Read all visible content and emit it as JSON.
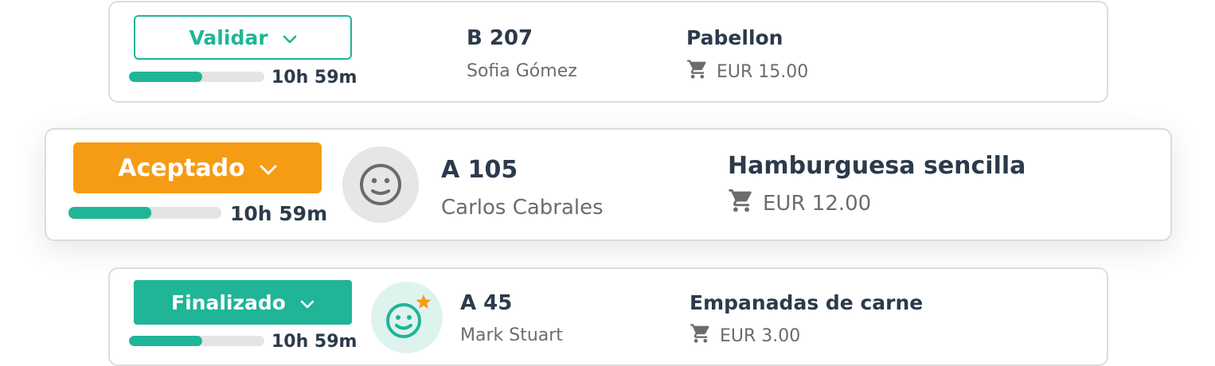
{
  "colors": {
    "accent_green": "#1fb596",
    "accent_orange": "#f69c14",
    "progress_track": "#e4e4e4",
    "text_dark": "#2c3a4b",
    "text_muted": "#6c6c6c"
  },
  "orders": [
    {
      "status_label": "Validar",
      "status_icon": "chevron-down-icon",
      "progress_fraction": 0.54,
      "time": "10h 59m",
      "ref": "B 207",
      "customer": "Sofia Gómez",
      "product": "Pabellon",
      "price": "EUR 15.00",
      "cart_icon": "cart-icon"
    },
    {
      "status_label": "Aceptado",
      "status_icon": "chevron-down-icon",
      "progress_fraction": 0.54,
      "time": "10h 59m",
      "avatar_icon": "neutral-face-icon",
      "ref": "A 105",
      "customer": "Carlos Cabrales",
      "product": "Hamburguesa sencilla",
      "price": "EUR 12.00",
      "cart_icon": "cart-icon"
    },
    {
      "status_label": "Finalizado",
      "status_icon": "chevron-down-icon",
      "progress_fraction": 0.54,
      "time": "10h 59m",
      "avatar_icon": "smiley-star-icon",
      "ref": "A 45",
      "customer": "Mark Stuart",
      "product": "Empanadas de carne",
      "price": "EUR 3.00",
      "cart_icon": "cart-icon"
    }
  ]
}
